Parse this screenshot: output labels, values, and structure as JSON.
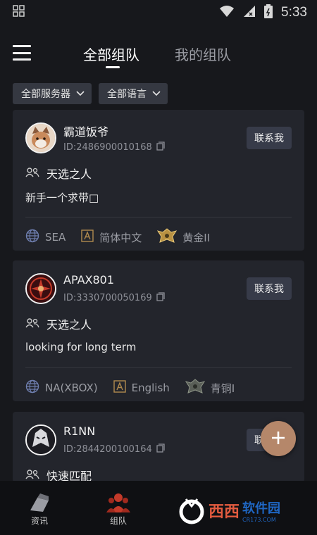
{
  "status_bar": {
    "time": "5:33"
  },
  "header": {
    "tabs": [
      {
        "label": "全部组队",
        "active": true
      },
      {
        "label": "我的组队",
        "active": false
      }
    ]
  },
  "filters": [
    {
      "label": "全部服务器"
    },
    {
      "label": "全部语言"
    }
  ],
  "cards": [
    {
      "name": "霸道饭爷",
      "id": "ID:2486900010168",
      "contact": "联系我",
      "mode": "天选之人",
      "description": "新手一个求带□",
      "region": "SEA",
      "language": "简体中文",
      "rank": "黄金II"
    },
    {
      "name": "APAX801",
      "id": "ID:3330700050169",
      "contact": "联系我",
      "mode": "天选之人",
      "description": "looking for long term",
      "region": "NA(XBOX)",
      "language": "English",
      "rank": "青铜I"
    },
    {
      "name": "R1NN",
      "id": "ID:2844200100164",
      "contact": "联系我",
      "mode": "快速匹配"
    }
  ],
  "fab": {
    "icon": "plus-icon"
  },
  "bottom_nav": {
    "items": [
      {
        "label": "资讯",
        "icon": "news-icon"
      },
      {
        "label": "组队",
        "icon": "team-icon",
        "active": true
      }
    ]
  },
  "watermark": {
    "main": "西西",
    "sub": "软件园",
    "url": "CR173.COM"
  },
  "colors": {
    "background": "#17181c",
    "card": "#23252c",
    "button": "#373b49",
    "fab": "#b5876a",
    "accent_red": "#c43a2a"
  }
}
